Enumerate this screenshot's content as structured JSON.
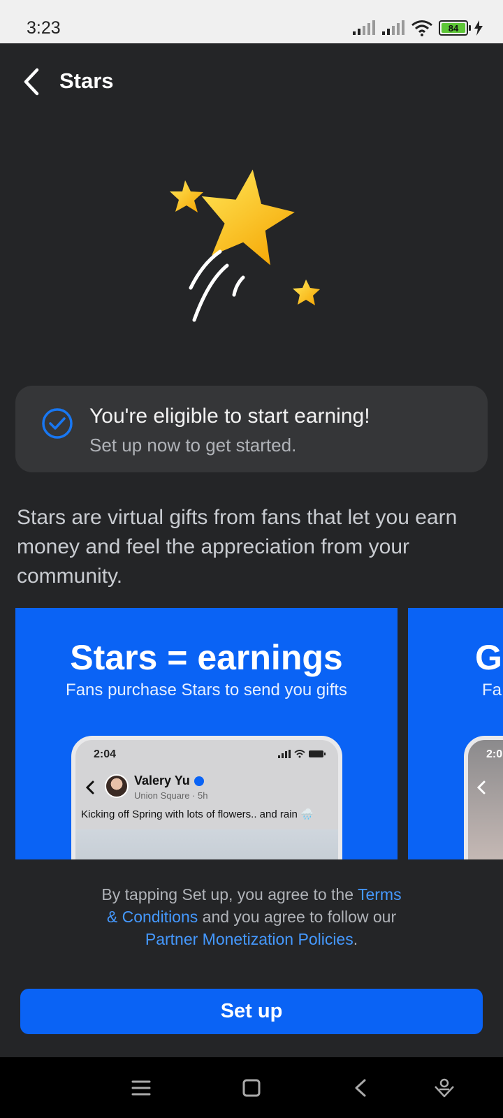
{
  "status_bar": {
    "time": "3:23",
    "battery": "84",
    "icons": [
      "signal-icon",
      "signal-icon",
      "wifi-icon",
      "battery-icon",
      "charging-icon"
    ]
  },
  "header": {
    "title": "Stars",
    "back_icon": "back-arrow-icon"
  },
  "hero": {
    "icon": "stars-illustration"
  },
  "eligibility": {
    "title": "You're eligible to start earning!",
    "subtitle": "Set up now to get started.",
    "icon": "check-circle-icon"
  },
  "description": "Stars are virtual gifts from fans that let you earn money and feel the appreciation from your community.",
  "carousel": {
    "slides": [
      {
        "title": "Stars = earnings",
        "subtitle": "Fans purchase Stars to send you gifts",
        "phone": {
          "time": "2:04",
          "name": "Valery Yu",
          "meta": "Union Square · 5h",
          "post": "Kicking off Spring with lots of flowers.. and rain 🌧️"
        }
      },
      {
        "title": "G",
        "subtitle": "Fa",
        "phone": {
          "time": "2:0"
        }
      }
    ]
  },
  "legal": {
    "part1": "By tapping Set up, you agree to the ",
    "terms_link": "Terms & Conditions",
    "part2": " and you agree to follow our ",
    "policy_link": "Partner Monetization Policies",
    "part3": "."
  },
  "setup_button": "Set up",
  "colors": {
    "background": "#242527",
    "accent": "#0a63f5",
    "link": "#4599ff",
    "card": "#353638"
  },
  "nav_bar": {
    "icons": [
      "menu-icon",
      "home-square-icon",
      "back-triangle-icon",
      "assistant-icon"
    ]
  }
}
